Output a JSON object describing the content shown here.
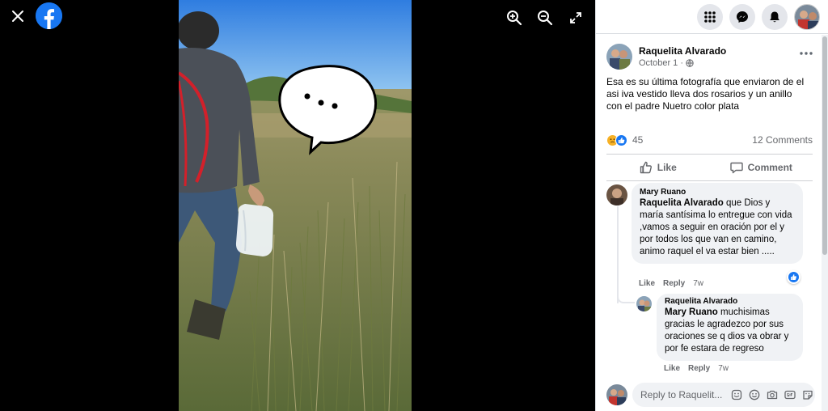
{
  "viewer": {
    "close_label": "Close",
    "brand": "facebook"
  },
  "post": {
    "author": "Raquelita Alvarado",
    "date": "October 1 ·",
    "text": "Esa es su última fotografía que enviaron de el asi iva vestido lleva dos rosarios y un anillo con el padre Nuetro color plata",
    "reaction_count": "45",
    "comments_count": "12 Comments",
    "like_label": "Like",
    "comment_label": "Comment"
  },
  "comments": [
    {
      "name": "Mary Ruano",
      "mention": "Raquelita Alvarado",
      "text": " que Dios y maría santísima lo entregue con vida ,vamos a seguir en oración por el y por todos los que van en camino, animo raquel el va estar bien .....",
      "like": "Like",
      "reply": "Reply",
      "time": "7w"
    },
    {
      "name": "Raquelita Alvarado",
      "mention": "Mary Ruano",
      "text": " muchisimas gracias le agradezco por sus oraciones se q dios va obrar y por fe estara de regreso",
      "like": "Like",
      "reply": "Reply",
      "time": "7w"
    }
  ],
  "reply_box": {
    "placeholder": "Reply to Raquelit..."
  },
  "colors": {
    "brand_blue": "#1877f2",
    "panel_bg": "#ffffff",
    "bubble_bg": "#f0f2f5",
    "secondary_text": "#65676b"
  },
  "icons": [
    "close-icon",
    "facebook-logo-icon",
    "zoom-in-icon",
    "zoom-out-icon",
    "fullscreen-icon",
    "menu-grid-icon",
    "messenger-icon",
    "notifications-bell-icon",
    "globe-icon",
    "more-dots-icon",
    "like-thumb-icon",
    "comment-icon",
    "sad-reaction-icon",
    "sticker-icon",
    "emoji-icon",
    "camera-icon",
    "gif-icon",
    "avatar-sticker-icon"
  ]
}
